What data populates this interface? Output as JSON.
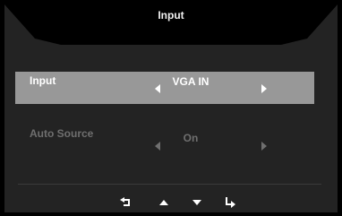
{
  "menu": {
    "title": "Input",
    "rows": [
      {
        "label": "Input",
        "value": "VGA IN"
      },
      {
        "label": "Auto Source",
        "value": "On"
      }
    ]
  },
  "nav_icons": [
    "return-icon",
    "up-arrow-icon",
    "down-arrow-icon",
    "enter-icon"
  ],
  "colors": {
    "panel": "#232323",
    "selected_row": "#989898",
    "text": "#ffffff",
    "disabled_text": "#6f6f6f"
  }
}
